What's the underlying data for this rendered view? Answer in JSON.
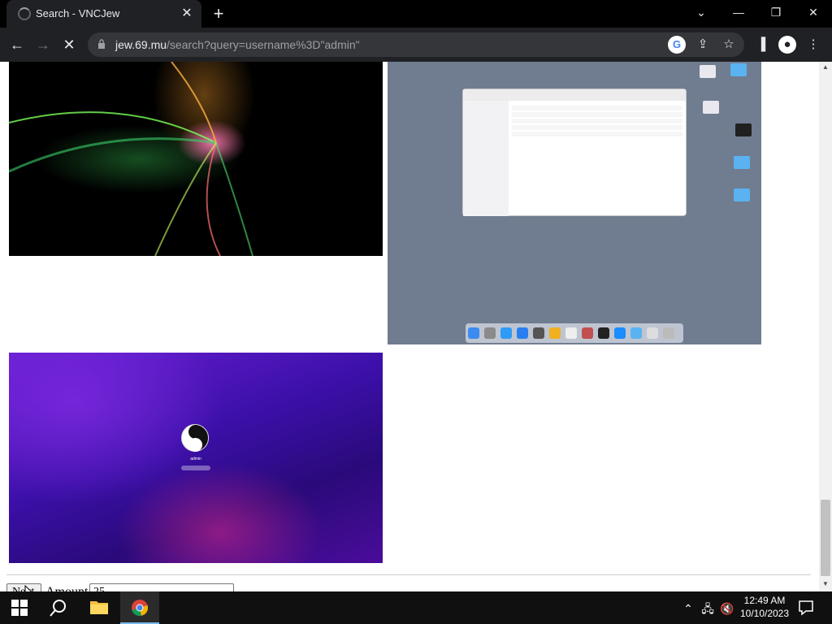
{
  "browser": {
    "tab_title": "Search - VNCJew",
    "url_host": "jew.69.mu",
    "url_path": "/search?query=username%3D\"admin\""
  },
  "page": {
    "login_screen_username": "admin",
    "next_label": "Next",
    "amount_label": "Amount",
    "amount_value": "25"
  },
  "taskbar": {
    "time": "12:49 AM",
    "date": "10/10/2023"
  },
  "colors": {
    "chrome_dark": "#202124",
    "taskbar": "#101010",
    "accent_blue": "#76b9ed"
  }
}
